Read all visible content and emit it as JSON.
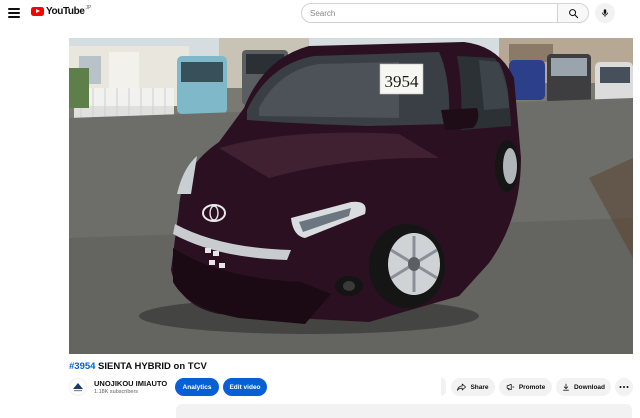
{
  "masthead": {
    "logo_text": "YouTube",
    "logo_country": "JP",
    "search_placeholder": "Search",
    "icons": [
      "menu-icon",
      "search-icon",
      "mic-icon"
    ]
  },
  "video": {
    "plate_number": "3954",
    "title_hashtag": "#3954",
    "title_rest": " SIENTA HYBRID on TCV"
  },
  "channel": {
    "name": "UNOJIKOU IMIAUTO",
    "subscribers": "1.18K subscribers"
  },
  "actions": {
    "analytics": "Analytics",
    "edit_video": "Edit video",
    "share": "Share",
    "promote": "Promote",
    "download": "Download"
  },
  "colors": {
    "brand_red": "#ff0000",
    "link_blue": "#065fd4",
    "car_body": "#2a1020"
  }
}
